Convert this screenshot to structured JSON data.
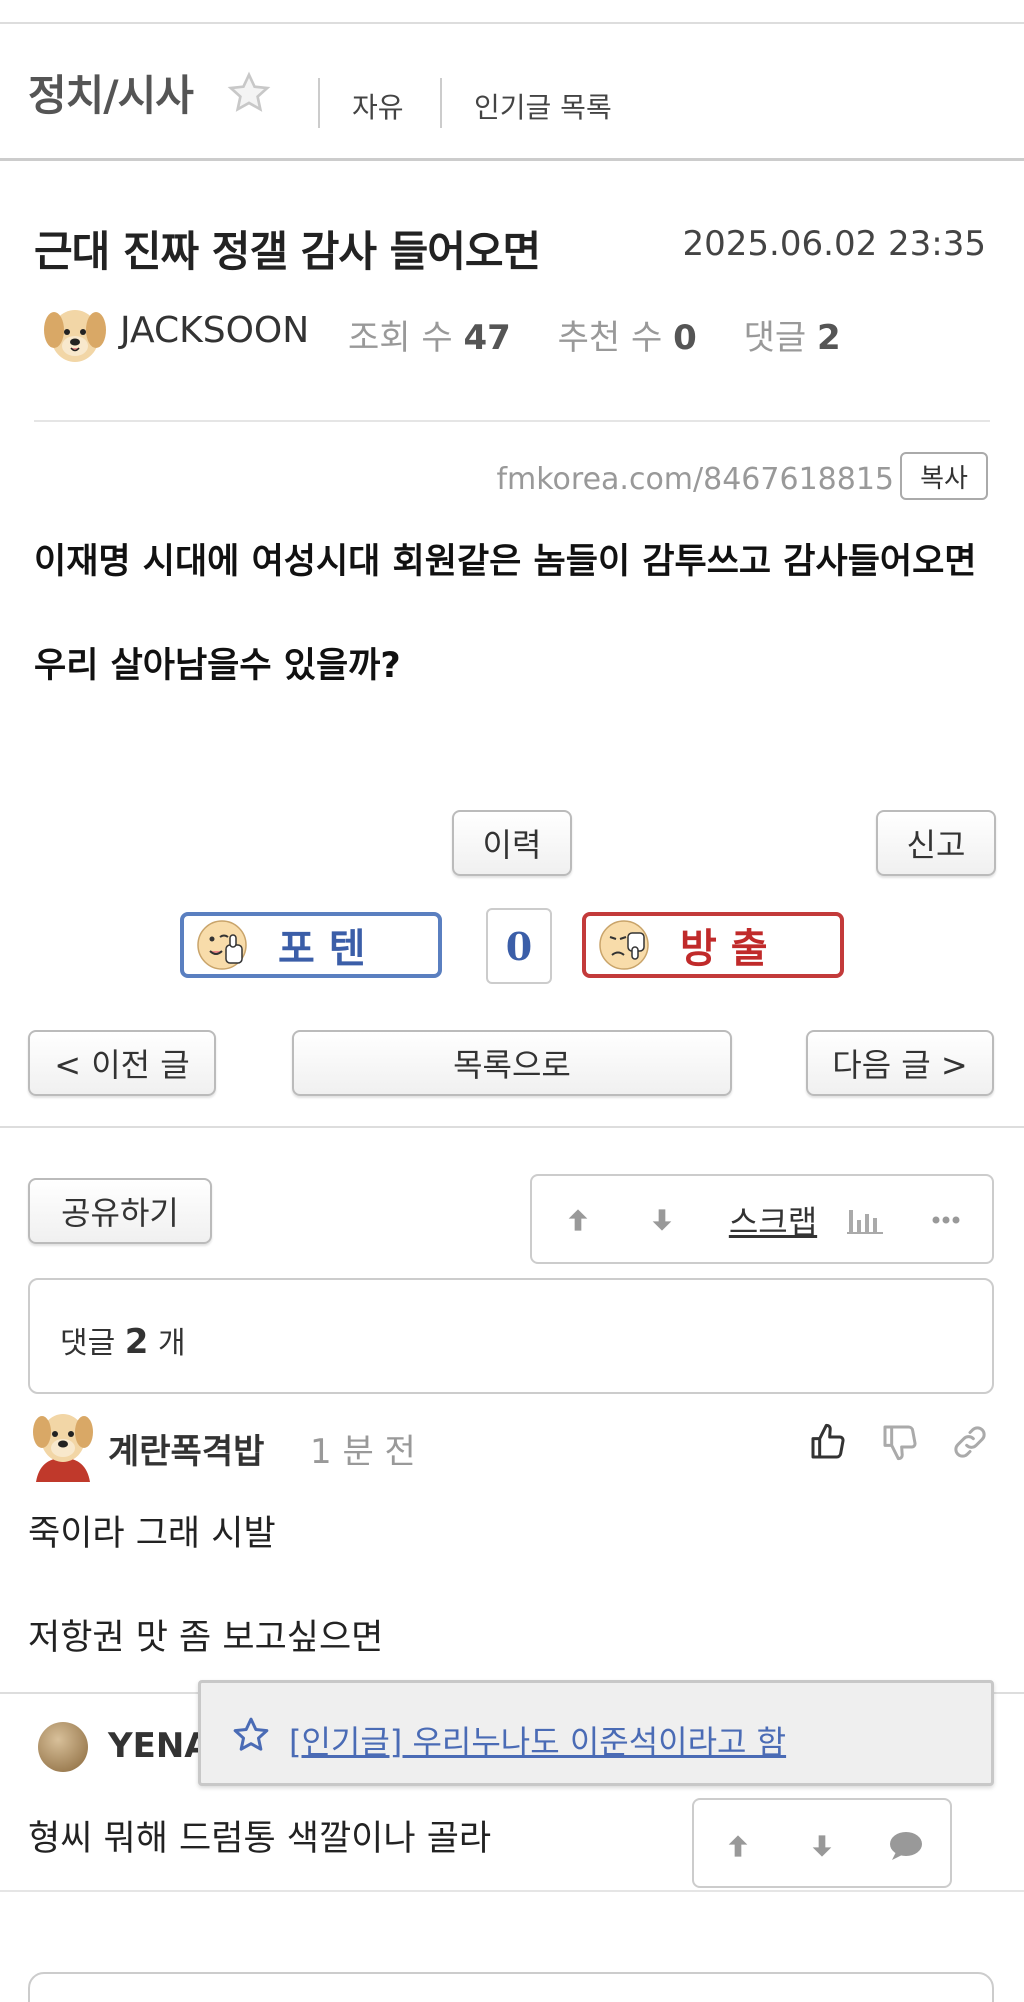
{
  "header": {
    "board_title": "정치/시사",
    "tabs": [
      "자유",
      "인기글 목록"
    ]
  },
  "post": {
    "title": "근대 진짜 정갤 감사 들어오면",
    "date": "2025.06.02 23:35",
    "author": "JACKSOON",
    "views_label": "조회 수",
    "views": "47",
    "recommends_label": "추천 수",
    "recommends": "0",
    "comments_label": "댓글",
    "comments": "2",
    "url": "fmkorea.com/8467618815",
    "copy_label": "복사",
    "body": [
      "이재명 시대에 여성시대 회원같은 놈들이 감투쓰고 감사들어오면",
      "우리 살아남을수 있을까?"
    ]
  },
  "actions": {
    "history": "이력",
    "report": "신고",
    "vote_up": "포 텐",
    "vote_count": "0",
    "vote_down": "방 출",
    "prev": "< 이전 글",
    "list": "목록으로",
    "next": "다음 글 >",
    "share": "공유하기",
    "scrap": "스크랩"
  },
  "comments_header": {
    "label": "댓글",
    "count": "2",
    "unit": "개"
  },
  "comments": [
    {
      "author": "계란폭격밥",
      "time": "1 분 전",
      "lines": [
        "죽이라 그래 시발",
        "저항권 맛 좀 보고싶으면"
      ]
    },
    {
      "author": "YENA",
      "text": "형씨 뭐해 드럼통 색깔이나 골라"
    }
  ],
  "popup": {
    "link": "[인기글] 우리누나도 이준석이라고 함"
  },
  "colors": {
    "potten_blue": "#5a7fc0",
    "bangchul_red": "#c33a3a",
    "link_blue": "#4a6bb5"
  }
}
